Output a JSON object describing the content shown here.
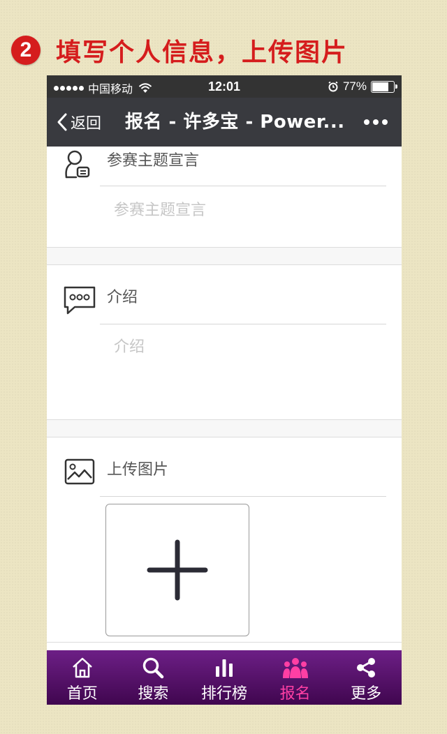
{
  "banner": {
    "step": "2",
    "text": "填写个人信息，上传图片"
  },
  "statusbar": {
    "carrier": "中国移动",
    "time": "12:01",
    "battery": "77%",
    "battery_level": 0.77
  },
  "navbar": {
    "back": "返回",
    "title": "报名 - 许多宝 - Power..."
  },
  "form": {
    "declaration": {
      "label": "参赛主题宣言",
      "placeholder": "参赛主题宣言"
    },
    "intro": {
      "label": "介绍",
      "placeholder": "介绍"
    },
    "upload": {
      "label": "上传图片"
    }
  },
  "tabs": [
    {
      "label": "首页",
      "icon": "home-icon"
    },
    {
      "label": "搜索",
      "icon": "search-icon"
    },
    {
      "label": "排行榜",
      "icon": "ranking-icon"
    },
    {
      "label": "报名",
      "icon": "signup-icon",
      "active": true
    },
    {
      "label": "更多",
      "icon": "share-icon"
    }
  ],
  "colors": {
    "accent": "#d51d1d",
    "tabbar": "#5a1070",
    "active_tab": "#ff3fa4",
    "navbar": "#393a3f"
  }
}
